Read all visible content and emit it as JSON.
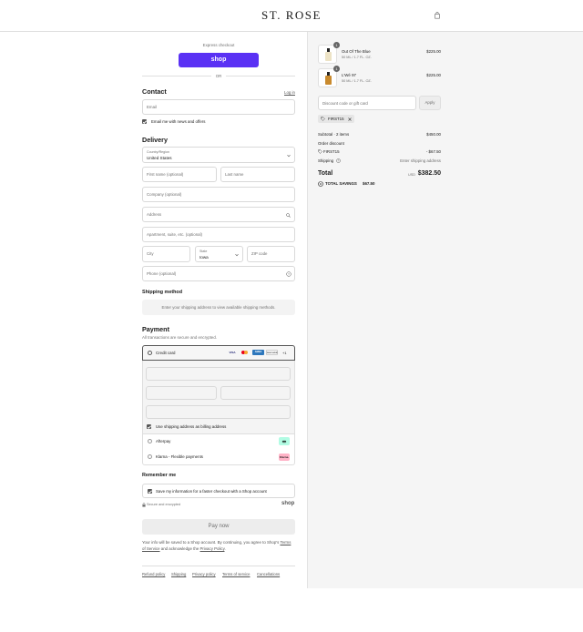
{
  "brand": {
    "name": "ST. ROSE"
  },
  "express": {
    "label": "Express checkout",
    "shop_button": "shop",
    "or": "OR"
  },
  "contact": {
    "heading": "Contact",
    "login": "Log in",
    "email_placeholder": "Email",
    "news_label": "Email me with news and offers"
  },
  "delivery": {
    "heading": "Delivery",
    "country_label": "Country/Region",
    "country_value": "United States",
    "first_name": "First name (optional)",
    "last_name": "Last name",
    "company": "Company (optional)",
    "address": "Address",
    "apartment": "Apartment, suite, etc. (optional)",
    "city": "City",
    "state_label": "State",
    "state_value": "Iowa",
    "zip": "ZIP code",
    "phone": "Phone (optional)"
  },
  "shipping": {
    "heading": "Shipping method",
    "notice": "Enter your shipping address to view available shipping methods."
  },
  "payment": {
    "heading": "Payment",
    "subtitle": "All transactions are secure and encrypted.",
    "credit_card": "Credit card",
    "card_brands": [
      "VISA",
      "MC",
      "AMEX",
      "DISCOVER"
    ],
    "more_cards": "+1",
    "billing_same": "Use shipping address as billing address",
    "afterpay": "Afterpay",
    "klarna": "Klarna - Flexible payments",
    "klarna_badge": "Klarna."
  },
  "remember": {
    "heading": "Remember me",
    "save_label": "Save my information for a faster checkout with a Shop account",
    "secure": "Secure and encrypted",
    "shop": "shop"
  },
  "pay": {
    "button": "Pay now",
    "legal_1": "Your info will be saved to a Shop account. By continuing, you agree to Shop's",
    "terms": "Terms of Service",
    "legal_2": "and acknowledge the",
    "privacy": "Privacy Policy",
    "legal_end": "."
  },
  "footer_links": [
    "Refund policy",
    "Shipping",
    "Privacy policy",
    "Terms of service",
    "Cancellations"
  ],
  "cart": {
    "items": [
      {
        "qty": "1",
        "name": "Out Of The Blue",
        "variant": "50 ML / 1.7 FL. OZ.",
        "price": "$225.00"
      },
      {
        "qty": "1",
        "name": "L'Wé 97",
        "variant": "50 ML / 1.7 FL. OZ.",
        "price": "$225.00"
      }
    ],
    "discount_placeholder": "Discount code or gift card",
    "apply": "Apply",
    "code_chip": "FIRST15"
  },
  "summary": {
    "subtotal_label": "Subtotal · 2 items",
    "subtotal_value": "$450.00",
    "order_discount": "Order discount",
    "discount_code": "FIRST15",
    "discount_value": "- $67.50",
    "shipping_label": "Shipping",
    "shipping_value": "Enter shipping address",
    "total_label": "Total",
    "currency": "USD",
    "total_value": "$382.50",
    "savings_label": "TOTAL SAVINGS",
    "savings_value": "$67.50"
  },
  "colors": {
    "shop_purple": "#5a31f4",
    "afterpay_mint": "#b2fce4",
    "klarna_pink": "#ffb3c7"
  }
}
